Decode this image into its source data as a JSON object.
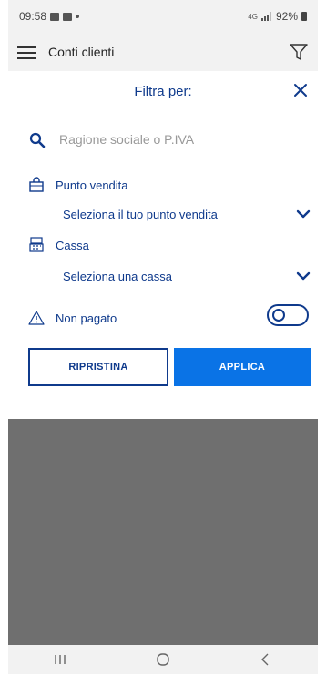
{
  "status_bar": {
    "time": "09:58",
    "network": "4G",
    "battery": "92%"
  },
  "app_bar": {
    "title": "Conti clienti",
    "menu_icon": "hamburger-menu-icon",
    "filter_icon": "filter-icon"
  },
  "filter_panel": {
    "title": "Filtra per:",
    "close_icon": "close-icon",
    "search": {
      "placeholder": "Ragione sociale o P.IVA",
      "value": ""
    },
    "store": {
      "label": "Punto vendita",
      "selected": "Seleziona il tuo punto vendita"
    },
    "register": {
      "label": "Cassa",
      "selected": "Seleziona una cassa"
    },
    "unpaid": {
      "label": "Non pagato",
      "enabled": false
    },
    "buttons": {
      "reset_label": "RIPRISTINA",
      "apply_label": "APPLICA"
    }
  },
  "colors": {
    "primary": "#0f3a8c",
    "accent": "#0a73e6",
    "scrim": "#6f6f6f"
  }
}
